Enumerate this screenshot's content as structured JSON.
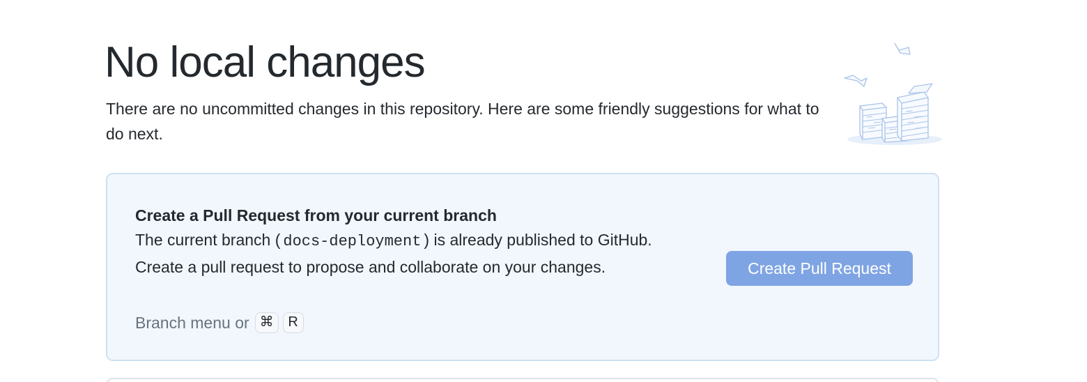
{
  "header": {
    "title": "No local changes",
    "subtitle": "There are no uncommitted changes in this repository. Here are some friendly suggestions for what to do next."
  },
  "illustration": {
    "icon": "paper-stacks-illustration-icon"
  },
  "pull_request_card": {
    "title": "Create a Pull Request from your current branch",
    "description_prefix": "The current branch (",
    "branch_name": "docs-deployment",
    "description_suffix": ") is already published to GitHub. Create a pull request to propose and collaborate on your changes.",
    "shortcut_prefix": "Branch menu or",
    "shortcut_keys": [
      "⌘",
      "R"
    ],
    "button_label": "Create Pull Request"
  },
  "colors": {
    "card_background": "#f1f7fd",
    "card_border": "#cfe1f2",
    "button_background": "#7ea4e3",
    "text": "#24292e",
    "muted_text": "#6a737d"
  }
}
